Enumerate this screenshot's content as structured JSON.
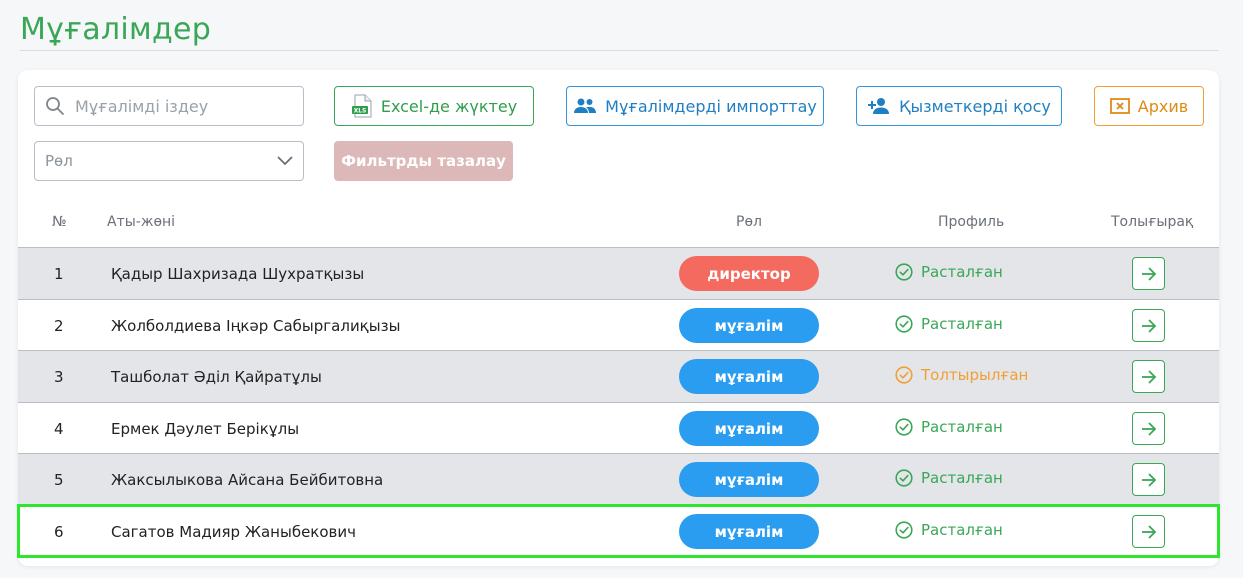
{
  "page": {
    "title": "Мұғалімдер"
  },
  "filters": {
    "search_placeholder": "Мұғалімді іздеу",
    "role_placeholder": "Рөл",
    "clear_label": "Фильтрды тазалау"
  },
  "toolbar": {
    "excel_label": "Excel-де жүктеу",
    "import_label": "Мұғалімдерді импорттау",
    "add_label": "Қызметкерді қосу",
    "archive_label": "Архив"
  },
  "table": {
    "headers": {
      "num": "№",
      "name": "Аты-жөні",
      "role": "Рөл",
      "profile": "Профиль",
      "more": "Толығырақ"
    },
    "rows": [
      {
        "num": "1",
        "name": "Қадыр Шахризада Шухратқызы",
        "role": "директор",
        "status": "Расталған"
      },
      {
        "num": "2",
        "name": "Жолболдиева Іңкәр Сабыргалиқызы",
        "role": "мұғалім",
        "status": "Расталған"
      },
      {
        "num": "3",
        "name": "Ташболат Әділ Қайратұлы",
        "role": "мұғалім",
        "status": "Толтырылған"
      },
      {
        "num": "4",
        "name": "Ермек Дәулет Берікұлы",
        "role": "мұғалім",
        "status": "Расталған"
      },
      {
        "num": "5",
        "name": "Жаксылыкова Айсана Бейбитовна",
        "role": "мұғалім",
        "status": "Расталған"
      },
      {
        "num": "6",
        "name": "Сагатов Мадияр Жаныбекович",
        "role": "мұғалім",
        "status": "Расталған"
      }
    ]
  },
  "colors": {
    "director": "#f46a5f",
    "teacher": "#2b9df0",
    "confirmed": "#3aa757",
    "filled": "#f0a033"
  },
  "icons": {
    "excel": "xls-file-icon",
    "import": "users-icon",
    "add": "add-user-icon",
    "archive": "archive-box-icon",
    "more": "arrow-right-icon"
  }
}
